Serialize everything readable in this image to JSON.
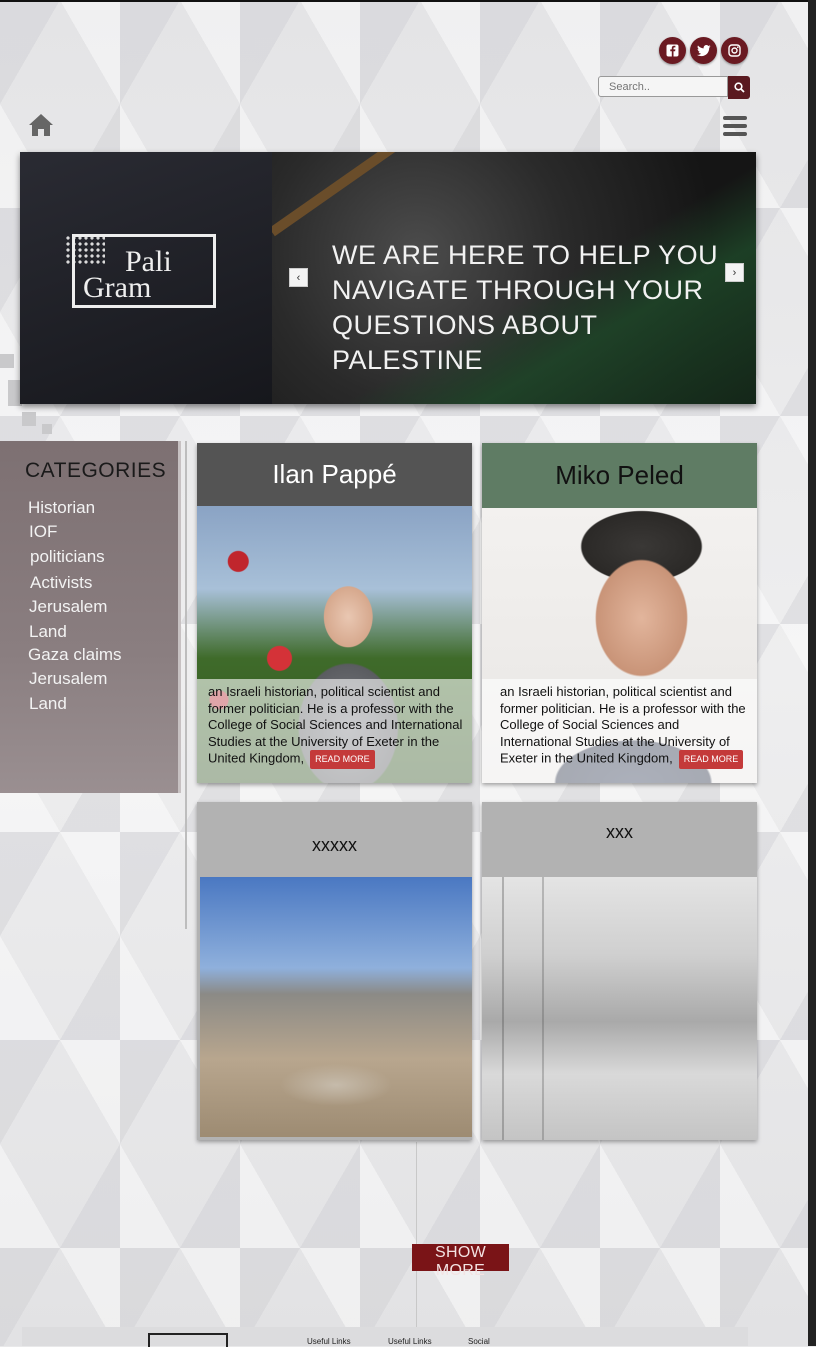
{
  "header": {
    "social": [
      {
        "icon": "facebook-icon"
      },
      {
        "icon": "twitter-icon"
      },
      {
        "icon": "instagram-icon"
      }
    ],
    "search_placeholder": "Search..",
    "home_icon": "home-icon",
    "menu_icon": "hamburger-menu-icon"
  },
  "hero": {
    "logo_line1": "Pali",
    "logo_line2": "Gram",
    "headline_lines": [
      "WE ARE HERE TO HELP YOU",
      "NAVIGATE THROUGH YOUR",
      "QUESTIONS ABOUT PALESTINE"
    ],
    "prev_symbol": "‹",
    "next_symbol": "›"
  },
  "categories": {
    "title": "CATEGORIES",
    "items": [
      "Historian",
      "IOF",
      "politicians",
      "Activists",
      "Jerusalem",
      "Land",
      "Gaza claims",
      "Jerusalem",
      "Land"
    ]
  },
  "cards": [
    {
      "title": "Ilan Pappé",
      "description": "an Israeli historian, political scientist and former politician. He is a professor with the College of Social Sciences and International Studies at the University of Exeter in the United Kingdom,",
      "read_more": "READ MORE"
    },
    {
      "title": "Miko Peled",
      "description": "an Israeli historian, political scientist and former politician. He is a professor with the College of Social Sciences and International Studies at the University of Exeter in the United Kingdom,",
      "read_more": "READ MORE"
    },
    {
      "title": "xxxxx"
    },
    {
      "title": "xxx"
    }
  ],
  "show_more": "SHOW MORE",
  "footer": {
    "links": [
      "Useful Links",
      "Useful Links",
      "Social"
    ]
  },
  "colors": {
    "accent": "#7a1417",
    "social_bg": "#6a1a22",
    "read_more": "#c43a3a"
  }
}
